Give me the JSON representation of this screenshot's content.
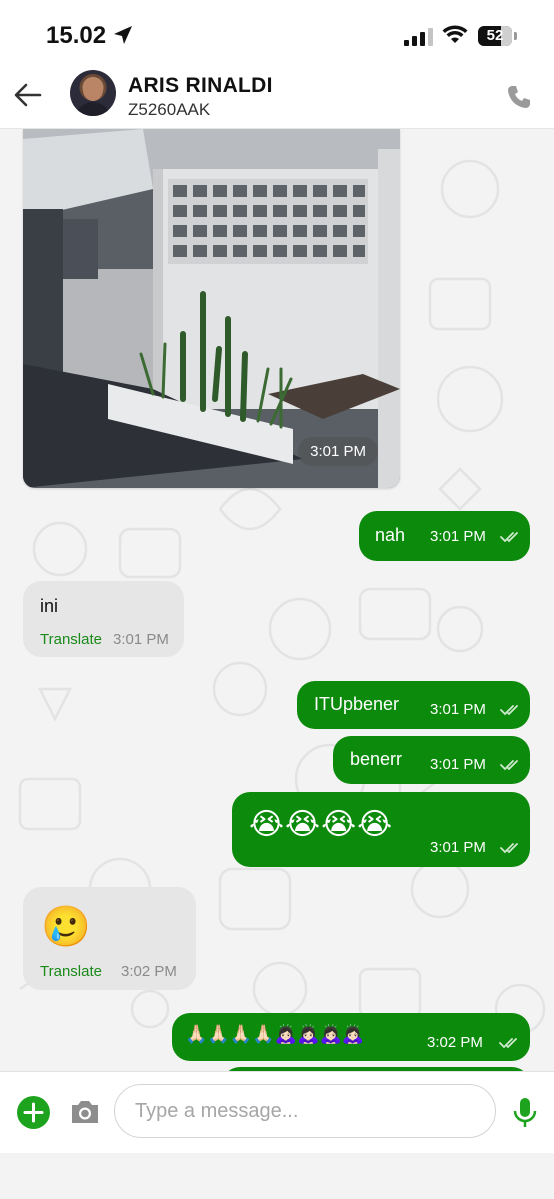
{
  "status": {
    "time": "15.02",
    "battery": "52"
  },
  "header": {
    "name": "ARIS RINALDI",
    "subtitle": "Z5260AAK"
  },
  "messages": [
    {
      "kind": "photo",
      "time": "3:01 PM"
    },
    {
      "kind": "out",
      "text": "nah",
      "time": "3:01 PM"
    },
    {
      "kind": "in",
      "text": "ini",
      "translate": "Translate",
      "time": "3:01 PM"
    },
    {
      "kind": "out",
      "text": "ITUpbener",
      "time": "3:01 PM"
    },
    {
      "kind": "out",
      "text": "benerr",
      "time": "3:01 PM"
    },
    {
      "kind": "out",
      "text": "😭😭😭😭",
      "time": "3:01 PM"
    },
    {
      "kind": "in",
      "text": "🥲",
      "translate": "Translate",
      "time": "3:02 PM"
    },
    {
      "kind": "out",
      "text": "🙏🏻🙏🏻🙏🏻🙏🏻🙇🏻‍♀️🙇🏻‍♀️🙇🏻‍♀️🙇🏻‍♀️",
      "time": "3:02 PM"
    }
  ],
  "composer": {
    "placeholder": "Type a message..."
  },
  "colors": {
    "outgoing": "#0b8a0b",
    "incoming": "#e6e6e6",
    "accent": "#1da31d"
  }
}
